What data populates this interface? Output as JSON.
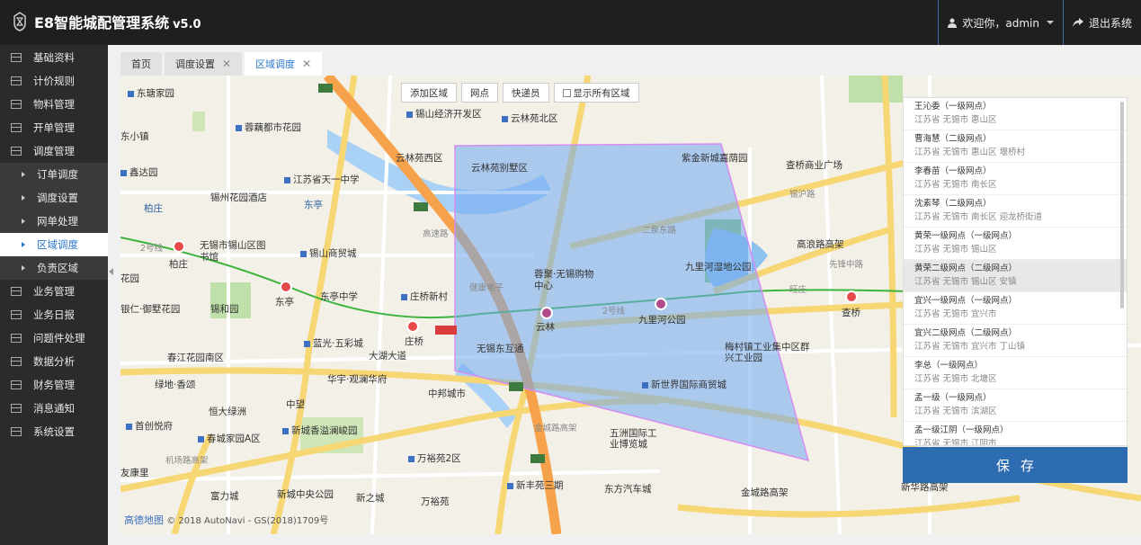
{
  "header": {
    "title": "E8智能城配管理系统",
    "version": "v5.0",
    "welcome": "欢迎你，admin",
    "logout": "退出系统"
  },
  "sidebar": {
    "items": [
      {
        "label": "基础资料"
      },
      {
        "label": "计价规则"
      },
      {
        "label": "物料管理"
      },
      {
        "label": "开单管理"
      },
      {
        "label": "调度管理"
      }
    ],
    "sub_items": [
      {
        "label": "订单调度"
      },
      {
        "label": "调度设置"
      },
      {
        "label": "网单处理"
      },
      {
        "label": "区域调度"
      },
      {
        "label": "负责区域"
      }
    ],
    "items_after": [
      {
        "label": "业务管理"
      },
      {
        "label": "业务日报"
      },
      {
        "label": "问题件处理"
      },
      {
        "label": "数据分析"
      },
      {
        "label": "财务管理"
      },
      {
        "label": "消息通知"
      },
      {
        "label": "系统设置"
      }
    ]
  },
  "tabs": [
    {
      "label": "首页",
      "closable": false
    },
    {
      "label": "调度设置",
      "closable": true
    },
    {
      "label": "区域调度",
      "closable": true,
      "active": true
    }
  ],
  "map_toolbar": {
    "add_area": "添加区域",
    "network_point": "网点",
    "courier": "快递员",
    "show_all": "显示所有区域"
  },
  "map_labels": {
    "l1": "东瑭家园",
    "l2": "蓉藕都市花园",
    "l3": "锡山经济开发区",
    "l4": "云林苑北区",
    "l5": "东小镇",
    "l6": "鑫达园",
    "l7": "江苏省天一中学",
    "l8": "云林苑西区",
    "l9": "云林苑别墅区",
    "l10": "紫金新城嘉荫园",
    "l11": "锡州花园酒店",
    "l12": "柏庄",
    "l13": "无锡市锡山区图书馆",
    "l14": "锡山商贸城",
    "l15": "蓉聚·无锡购物中心",
    "l16": "九里河湿地公园",
    "l17": "高浪路高架",
    "l18": "东亭",
    "l19": "东亭中学",
    "l20": "庄桥新村",
    "l21": "九里河公园",
    "l22": "锡和园",
    "l23": "银仁·御墅花园",
    "l24": "云林",
    "l25": "查桥",
    "l26": "庄桥",
    "l27": "蓝光·五彩城",
    "l28": "无锡东互通",
    "l29": "梅村镇工业集中区群兴工业园",
    "l30": "春江花园南区",
    "l31": "大湖大道",
    "l32": "华宇·观澜华府",
    "l33": "新世界国际商贸城",
    "l34": "绿地·香颂",
    "l35": "中邦城市",
    "l36": "恒大绿洲",
    "l37": "中望",
    "l38": "首创悦府",
    "l39": "新城香溢澜峻园",
    "l40": "五洲国际工业博览城",
    "l41": "春城家园A区",
    "l42": "万裕苑2区",
    "l43": "东方汽车城",
    "l44": "新丰苑三期",
    "l45": "金城路高架",
    "l46": "新华路高架",
    "l47": "富力城",
    "l48": "新城中央公园",
    "l49": "新之城",
    "l50": "万裕苑",
    "l51": "机场路高架",
    "l52": "二泉东路",
    "l53": "先锋中路",
    "l54": "友康里",
    "l55": "花园",
    "l56": "锡沪路",
    "l57": "查桥商业广场",
    "l58": "旺庄",
    "l59": "柏庄",
    "l60": "东亭",
    "l61": "健康电子",
    "l62": "金城路高架",
    "l63": "高速路",
    "l64": "2号线",
    "l65": "2号线"
  },
  "map_copyright": "© 2018 AutoNavi - GS(2018)1709号",
  "map_brand": "高德地图",
  "network_points": [
    {
      "name": "王沁委（一级网点）",
      "location": "江苏省 无锡市 惠山区"
    },
    {
      "name": "曹海慧（二级网点）",
      "location": "江苏省 无锡市 惠山区 堰桥村"
    },
    {
      "name": "李春苗（一级网点）",
      "location": "江苏省 无锡市 南长区"
    },
    {
      "name": "沈素琴（二级网点）",
      "location": "江苏省 无锡市 南长区 迎龙桥街道"
    },
    {
      "name": "黄荣一级网点（一级网点）",
      "location": "江苏省 无锡市 锡山区"
    },
    {
      "name": "黄荣二级网点（二级网点）",
      "location": "江苏省 无锡市 锡山区 安镇",
      "selected": true
    },
    {
      "name": "宜兴一级网点（一级网点）",
      "location": "江苏省 无锡市 宜兴市"
    },
    {
      "name": "宜兴二级网点（二级网点）",
      "location": "江苏省 无锡市 宜兴市 丁山镇"
    },
    {
      "name": "李总（一级网点）",
      "location": "江苏省 无锡市 北塘区"
    },
    {
      "name": "孟一级（一级网点）",
      "location": "江苏省 无锡市 滨湖区"
    },
    {
      "name": "孟一级江阴（一级网点）",
      "location": "江苏省 无锡市 江阴市"
    }
  ],
  "save_label": "保存",
  "colors": {
    "header_bg": "#1f1f1f",
    "sidebar_bg": "#2b2b2b",
    "accent": "#2a77c9",
    "save_bg": "#2d6cb0",
    "region_fill": "#6fa8f0"
  }
}
